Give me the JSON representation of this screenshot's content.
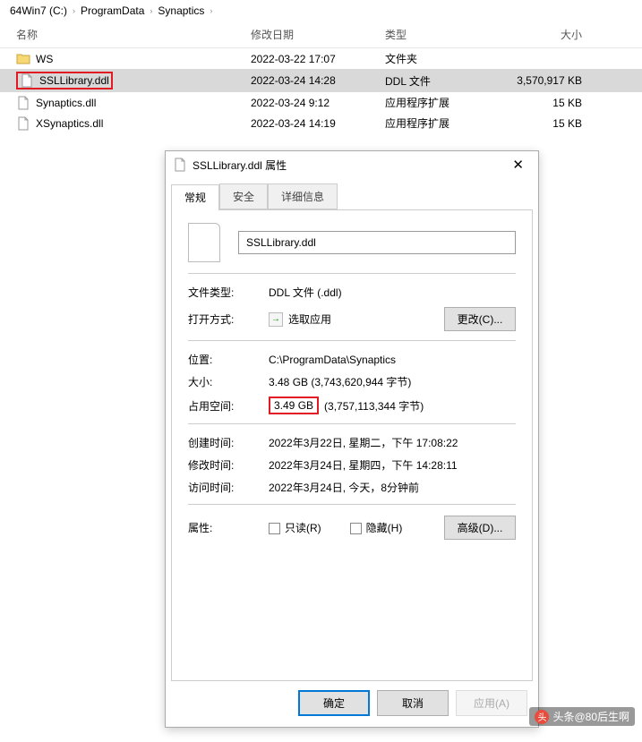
{
  "breadcrumb": {
    "items": [
      "64Win7  (C:)",
      "ProgramData",
      "Synaptics"
    ]
  },
  "columns": {
    "name": "名称",
    "date": "修改日期",
    "type": "类型",
    "size": "大小"
  },
  "files": [
    {
      "name": "WS",
      "date": "2022-03-22 17:07",
      "type": "文件夹",
      "size": "",
      "icon": "folder"
    },
    {
      "name": "SSLLibrary.ddl",
      "date": "2022-03-24 14:28",
      "type": "DDL 文件",
      "size": "3,570,917 KB",
      "icon": "file",
      "selected": true,
      "highlight": true
    },
    {
      "name": "Synaptics.dll",
      "date": "2022-03-24 9:12",
      "type": "应用程序扩展",
      "size": "15 KB",
      "icon": "file"
    },
    {
      "name": "XSynaptics.dll",
      "date": "2022-03-24 14:19",
      "type": "应用程序扩展",
      "size": "15 KB",
      "icon": "file"
    }
  ],
  "dialog": {
    "title": "SSLLibrary.ddl 属性",
    "tabs": {
      "general": "常规",
      "security": "安全",
      "details": "详细信息"
    },
    "filename": "SSLLibrary.ddl",
    "labels": {
      "filetype": "文件类型:",
      "opens_with": "打开方式:",
      "location": "位置:",
      "size": "大小:",
      "size_on_disk": "占用空间:",
      "created": "创建时间:",
      "modified": "修改时间:",
      "accessed": "访问时间:",
      "attributes": "属性:"
    },
    "values": {
      "filetype": "DDL 文件 (.ddl)",
      "opens_with": "选取应用",
      "change_btn": "更改(C)...",
      "location": "C:\\ProgramData\\Synaptics",
      "size": "3.48 GB (3,743,620,944 字节)",
      "size_on_disk_hl": "3.49 GB",
      "size_on_disk_rest": "(3,757,113,344 字节)",
      "created": "2022年3月22日, 星期二，下午 17:08:22",
      "modified": "2022年3月24日, 星期四，下午 14:28:11",
      "accessed": "2022年3月24日, 今天，8分钟前",
      "readonly": "只读(R)",
      "hidden": "隐藏(H)",
      "advanced_btn": "高级(D)..."
    },
    "buttons": {
      "ok": "确定",
      "cancel": "取消",
      "apply": "应用(A)"
    }
  },
  "watermark": "头条@80后生啊"
}
